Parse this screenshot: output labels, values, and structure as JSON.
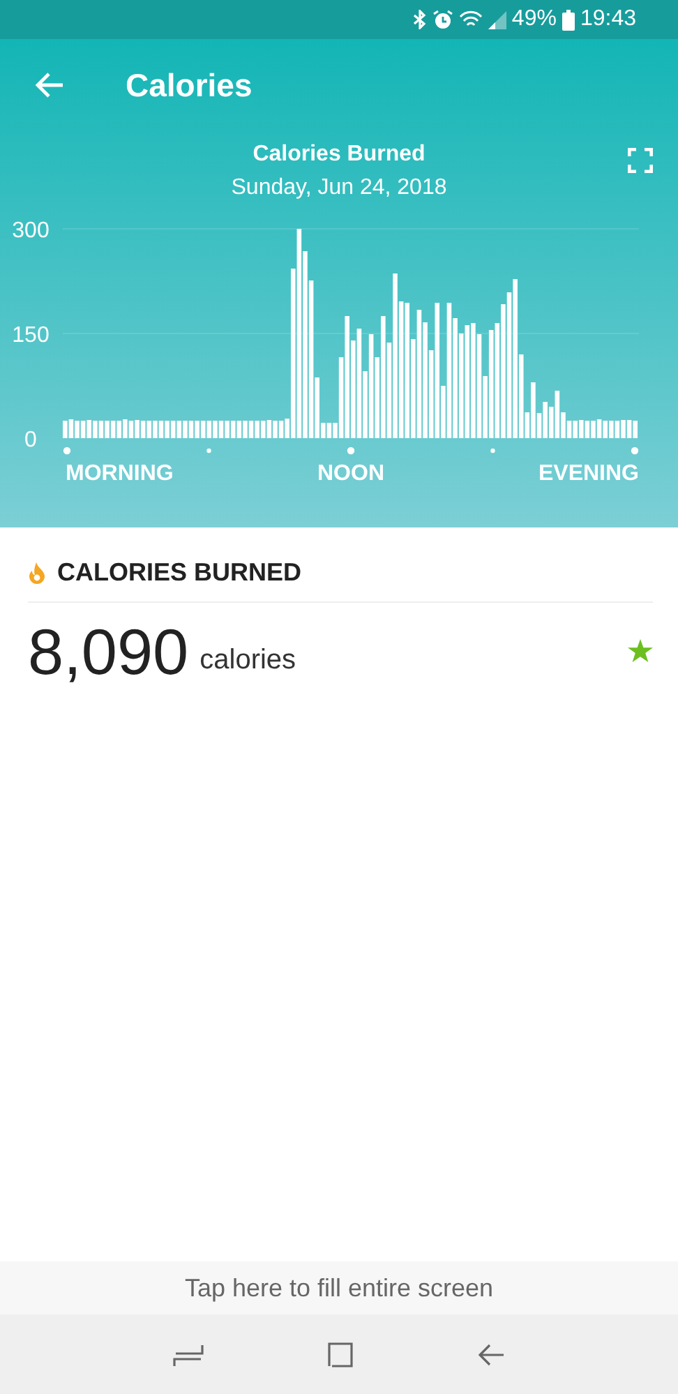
{
  "status_bar": {
    "battery": "49%",
    "time": "19:43"
  },
  "header": {
    "title": "Calories"
  },
  "chart": {
    "title": "Calories Burned",
    "date": "Sunday, Jun 24, 2018",
    "time_labels": [
      "MORNING",
      "NOON",
      "EVENING"
    ],
    "chart_data": {
      "type": "bar",
      "ylim": [
        0,
        300
      ],
      "yticks": [
        0,
        150,
        300
      ],
      "series": [
        {
          "color": "#ffffff",
          "values": [
            25,
            27,
            25,
            25,
            26,
            25,
            25,
            25,
            25,
            25,
            27,
            25,
            26,
            25,
            25,
            25,
            25,
            25,
            25,
            25,
            25,
            25,
            25,
            25,
            25,
            25,
            25,
            25,
            25,
            25,
            25,
            25,
            25,
            25,
            26,
            25,
            25,
            28,
            243,
            300,
            268,
            226,
            87,
            22,
            22,
            22,
            116,
            175,
            140,
            157,
            96,
            149,
            116,
            175,
            137,
            236,
            196,
            194,
            142,
            184,
            166,
            126,
            194,
            75,
            194,
            172,
            150,
            162,
            165,
            149,
            89,
            155,
            165,
            192,
            209,
            228,
            120,
            37,
            80,
            36,
            52,
            45,
            68,
            37,
            25,
            25,
            26,
            25,
            25,
            27,
            25,
            25,
            25,
            26,
            26,
            25
          ]
        }
      ]
    }
  },
  "summary": {
    "heading": "CALORIES BURNED",
    "value": "8,090",
    "unit": "calories",
    "goal_met": true
  },
  "fill_prompt": "Tap here to fill entire screen"
}
